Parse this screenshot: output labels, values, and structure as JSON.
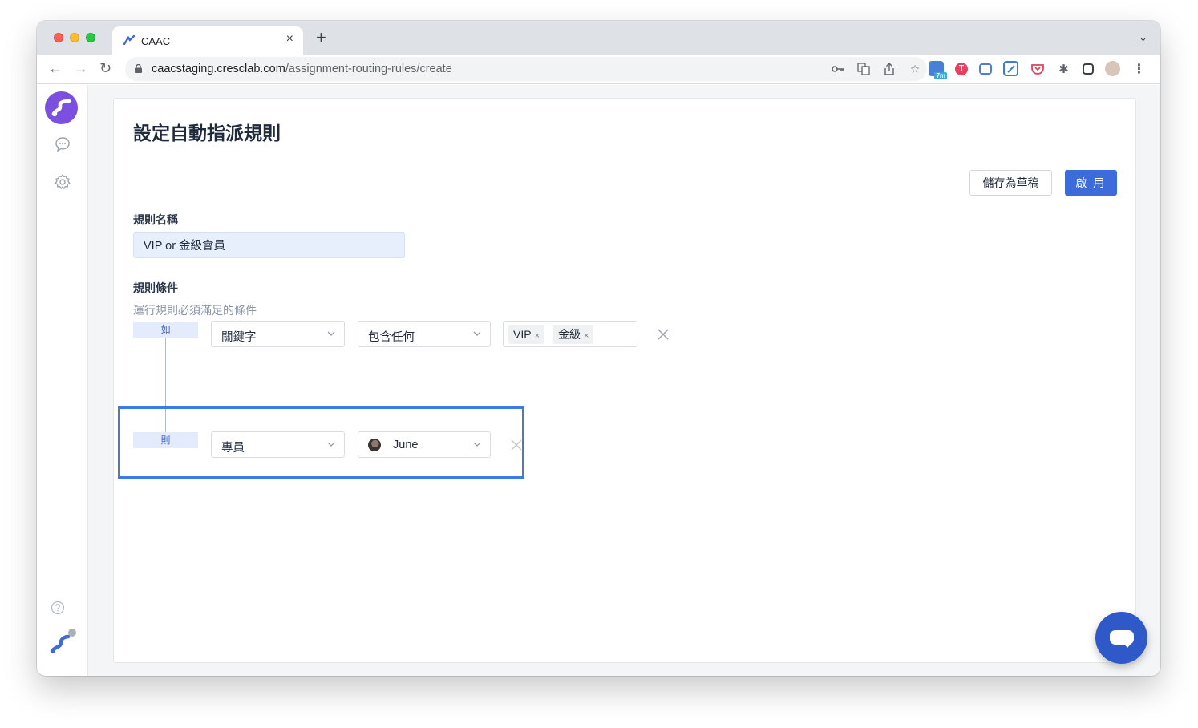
{
  "browser": {
    "tab_title": "CAAC",
    "url_host": "caacstaging.cresclab.com",
    "url_path": "/assignment-routing-rules/create",
    "extension_badge": "7m"
  },
  "page": {
    "title": "設定自動指派規則",
    "save_draft_label": "儲存為草稿",
    "enable_label": "啟 用"
  },
  "rule_name": {
    "label": "規則名稱",
    "value": "VIP or 金級會員"
  },
  "conditions": {
    "label": "規則條件",
    "hint": "運行規則必須滿足的條件",
    "if_tag": "如",
    "then_tag": "則",
    "if_field": "關鍵字",
    "if_operator": "包含任何",
    "keywords": [
      "VIP",
      "金級"
    ],
    "remove_symbol": "×",
    "then_field": "專員",
    "then_value": "June"
  },
  "colors": {
    "primary": "#3d6bdb",
    "highlight_border": "#3b7be8",
    "logo": "#7b4fe0"
  }
}
